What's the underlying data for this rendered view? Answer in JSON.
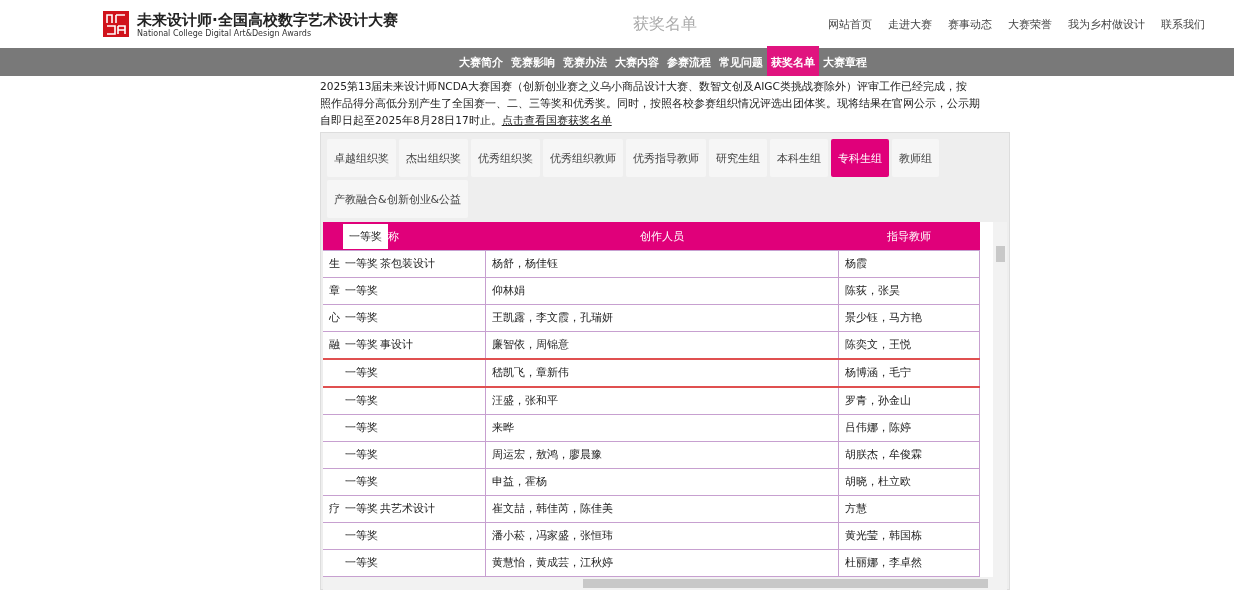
{
  "brand": {
    "title": "未来设计师·全国高校数字艺术设计大赛",
    "subtitle": "National College Digital Art&Design Awards"
  },
  "page_title": "获奖名单",
  "top_nav": [
    "网站首页",
    "走进大赛",
    "赛事动态",
    "大赛荣誉",
    "我为乡村做设计",
    "联系我们"
  ],
  "sub_nav": [
    {
      "label": "大赛简介",
      "selected": false
    },
    {
      "label": "竞赛影响",
      "selected": false
    },
    {
      "label": "竞赛办法",
      "selected": false
    },
    {
      "label": "大赛内容",
      "selected": false
    },
    {
      "label": "参赛流程",
      "selected": false
    },
    {
      "label": "常见问题",
      "selected": false
    },
    {
      "label": "获奖名单",
      "selected": true
    },
    {
      "label": "大赛章程",
      "selected": false
    }
  ],
  "intro": {
    "lines": [
      "2025第13届未来设计师NCDA大赛国赛（创新创业赛之义乌小商品设计大赛、数智文创及AIGC类挑战赛除外）评审工作已经完成，按",
      "照作品得分高低分别产生了全国赛一、二、三等奖和优秀奖。同时，按照各校参赛组织情况评选出团体奖。现将结果在官网公示，公示期",
      "自即日起至2025年8月28日17时止。"
    ],
    "link": "点击查看国赛获奖名单"
  },
  "tabs": [
    {
      "label": "卓越组织奖",
      "selected": false
    },
    {
      "label": "杰出组织奖",
      "selected": false
    },
    {
      "label": "优秀组织奖",
      "selected": false
    },
    {
      "label": "优秀组织教师",
      "selected": false
    },
    {
      "label": "优秀指导教师",
      "selected": false
    },
    {
      "label": "研究生组",
      "selected": false
    },
    {
      "label": "本科生组",
      "selected": false
    },
    {
      "label": "专科生组",
      "selected": true
    },
    {
      "label": "教师组",
      "selected": false
    },
    {
      "label": "产教融合&创新创业&公益",
      "selected": false
    }
  ],
  "table": {
    "frozen_header": "一等奖",
    "columns": [
      "称",
      "创作人员",
      "指导教师"
    ],
    "rows": [
      {
        "prefix": "生",
        "award": "一等奖",
        "suffix": "茶包装设计",
        "creators": "杨舒，杨佳钰",
        "advisors": "杨霞",
        "highlighted": false
      },
      {
        "prefix": "章",
        "award": "一等奖",
        "creators": "仰林娟",
        "advisors": "陈荻，张昊",
        "highlighted": false
      },
      {
        "prefix": "心",
        "award": "一等奖",
        "creators": "王凯露，李文霞，孔瑞妍",
        "advisors": "景少钰，马方艳",
        "highlighted": false
      },
      {
        "prefix": "融",
        "award": "一等奖",
        "suffix": "事设计",
        "creators": "廉智依，周锦意",
        "advisors": "陈奕文，王悦",
        "highlighted": false
      },
      {
        "award": "一等奖",
        "creators": "嵇凯飞，章新伟",
        "advisors": "杨博涵，毛宁",
        "highlighted": true
      },
      {
        "award": "一等奖",
        "creators": "汪盛，张和平",
        "advisors": "罗青，孙金山",
        "highlighted": false
      },
      {
        "award": "一等奖",
        "creators": "来晔",
        "advisors": "吕伟娜，陈婷",
        "highlighted": false
      },
      {
        "award": "一等奖",
        "creators": "周运宏，敖鸿，廖晨豫",
        "advisors": "胡朕杰，牟俊霖",
        "highlighted": false
      },
      {
        "award": "一等奖",
        "creators": "申益，霍杨",
        "advisors": "胡晓，杜立欧",
        "highlighted": false
      },
      {
        "prefix": "疗",
        "award": "一等奖",
        "suffix": "共艺术设计",
        "creators": "崔文喆，韩佳芮，陈佳美",
        "advisors": "方慧",
        "highlighted": false
      },
      {
        "award": "一等奖",
        "creators": "潘小菘，冯家盛，张恒玮",
        "advisors": "黄光莹，韩国栋",
        "highlighted": false
      },
      {
        "award": "一等奖",
        "creators": "黄慧怡，黄成芸，江秋婷",
        "advisors": "杜丽娜，李卓然",
        "highlighted": false
      }
    ]
  }
}
